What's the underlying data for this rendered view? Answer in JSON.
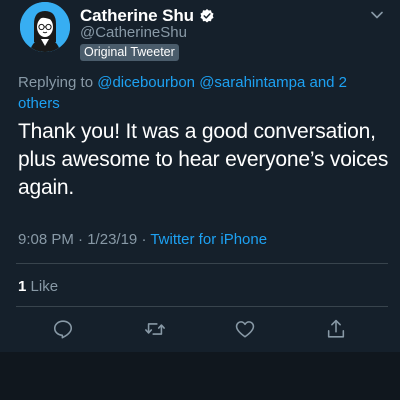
{
  "tweet": {
    "author": {
      "display_name": "Catherine Shu",
      "handle": "@CatherineShu",
      "verified": true,
      "badge": "Original Tweeter"
    },
    "reply_prefix": "Replying to",
    "reply_mention_1": "@dicebourbon",
    "reply_mention_2": "@sarahintampa",
    "reply_others": "and 2 others",
    "text": "Thank you! It was a good conversation, plus awesome to hear everyone’s voices again.",
    "time": "9:08 PM",
    "separator": "·",
    "date": "1/23/19",
    "source": "Twitter for iPhone",
    "like_count": "1",
    "like_label": "Like"
  },
  "colors": {
    "background": "#15202b",
    "accent": "#1da1f2",
    "secondary_text": "#8899a6",
    "divider": "#38444d",
    "avatar_bg": "#37aef2"
  },
  "icons": {
    "avatar": "avatar-illustration",
    "verified": "verified-badge-icon",
    "more": "chevron-down-icon",
    "reply": "reply-icon",
    "retweet": "retweet-icon",
    "like": "heart-icon",
    "share": "share-icon"
  }
}
